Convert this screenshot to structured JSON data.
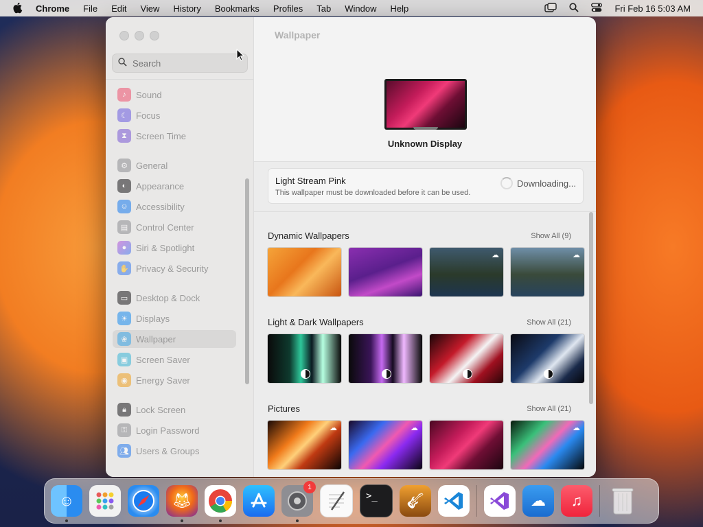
{
  "menubar": {
    "app": "Chrome",
    "items": [
      "File",
      "Edit",
      "View",
      "History",
      "Bookmarks",
      "Profiles",
      "Tab",
      "Window",
      "Help"
    ],
    "clock": "Fri Feb 16  5:03 AM"
  },
  "sidebar": {
    "search_placeholder": "Search",
    "items": [
      {
        "label": "Sound",
        "color": "#f0506e",
        "icon": "speaker-icon"
      },
      {
        "label": "Focus",
        "color": "#6a5ce0",
        "icon": "moon-icon"
      },
      {
        "label": "Screen Time",
        "color": "#7b5ad6",
        "icon": "hourglass-icon"
      },
      {
        "label": "General",
        "color": "#8e8e93",
        "icon": "gear-icon"
      },
      {
        "label": "Appearance",
        "color": "#1c1c1e",
        "icon": "appearance-icon"
      },
      {
        "label": "Accessibility",
        "color": "#1a7cf0",
        "icon": "accessibility-icon"
      },
      {
        "label": "Control Center",
        "color": "#8e8e93",
        "icon": "control-center-icon"
      },
      {
        "label": "Siri & Spotlight",
        "color": "#c04fd8",
        "icon": "siri-icon"
      },
      {
        "label": "Privacy & Security",
        "color": "#3a7cf0",
        "icon": "hand-icon"
      },
      {
        "label": "Desktop & Dock",
        "color": "#1c1c1e",
        "icon": "dock-icon"
      },
      {
        "label": "Displays",
        "color": "#1a8cf0",
        "icon": "sun-icon"
      },
      {
        "label": "Wallpaper",
        "color": "#3aa6e8",
        "icon": "wallpaper-icon"
      },
      {
        "label": "Screen Saver",
        "color": "#3ab6d8",
        "icon": "screensaver-icon"
      },
      {
        "label": "Energy Saver",
        "color": "#f0a020",
        "icon": "bulb-icon"
      },
      {
        "label": "Lock Screen",
        "color": "#1c1c1e",
        "icon": "lock-icon"
      },
      {
        "label": "Login Password",
        "color": "#8e8e93",
        "icon": "key-icon"
      },
      {
        "label": "Users & Groups",
        "color": "#2a7cf0",
        "icon": "users-icon"
      }
    ]
  },
  "main": {
    "title": "Wallpaper",
    "display_name": "Unknown Display",
    "current": {
      "name": "Light Stream Pink",
      "note": "This wallpaper must be downloaded before it can be used.",
      "status": "Downloading..."
    },
    "sections": [
      {
        "title": "Dynamic Wallpapers",
        "show_all": "Show All (9)"
      },
      {
        "title": "Light & Dark Wallpapers",
        "show_all": "Show All (21)"
      },
      {
        "title": "Pictures",
        "show_all": "Show All (21)"
      }
    ]
  },
  "dock": {
    "apps": [
      "Finder",
      "Launchpad",
      "Safari",
      "Firefox",
      "Chrome",
      "App Store",
      "System Settings",
      "TextEdit",
      "Terminal",
      "GarageBand",
      "Visual Studio Code",
      "Visual Studio",
      "Weather",
      "Music",
      "Trash"
    ],
    "settings_badge": "1"
  }
}
